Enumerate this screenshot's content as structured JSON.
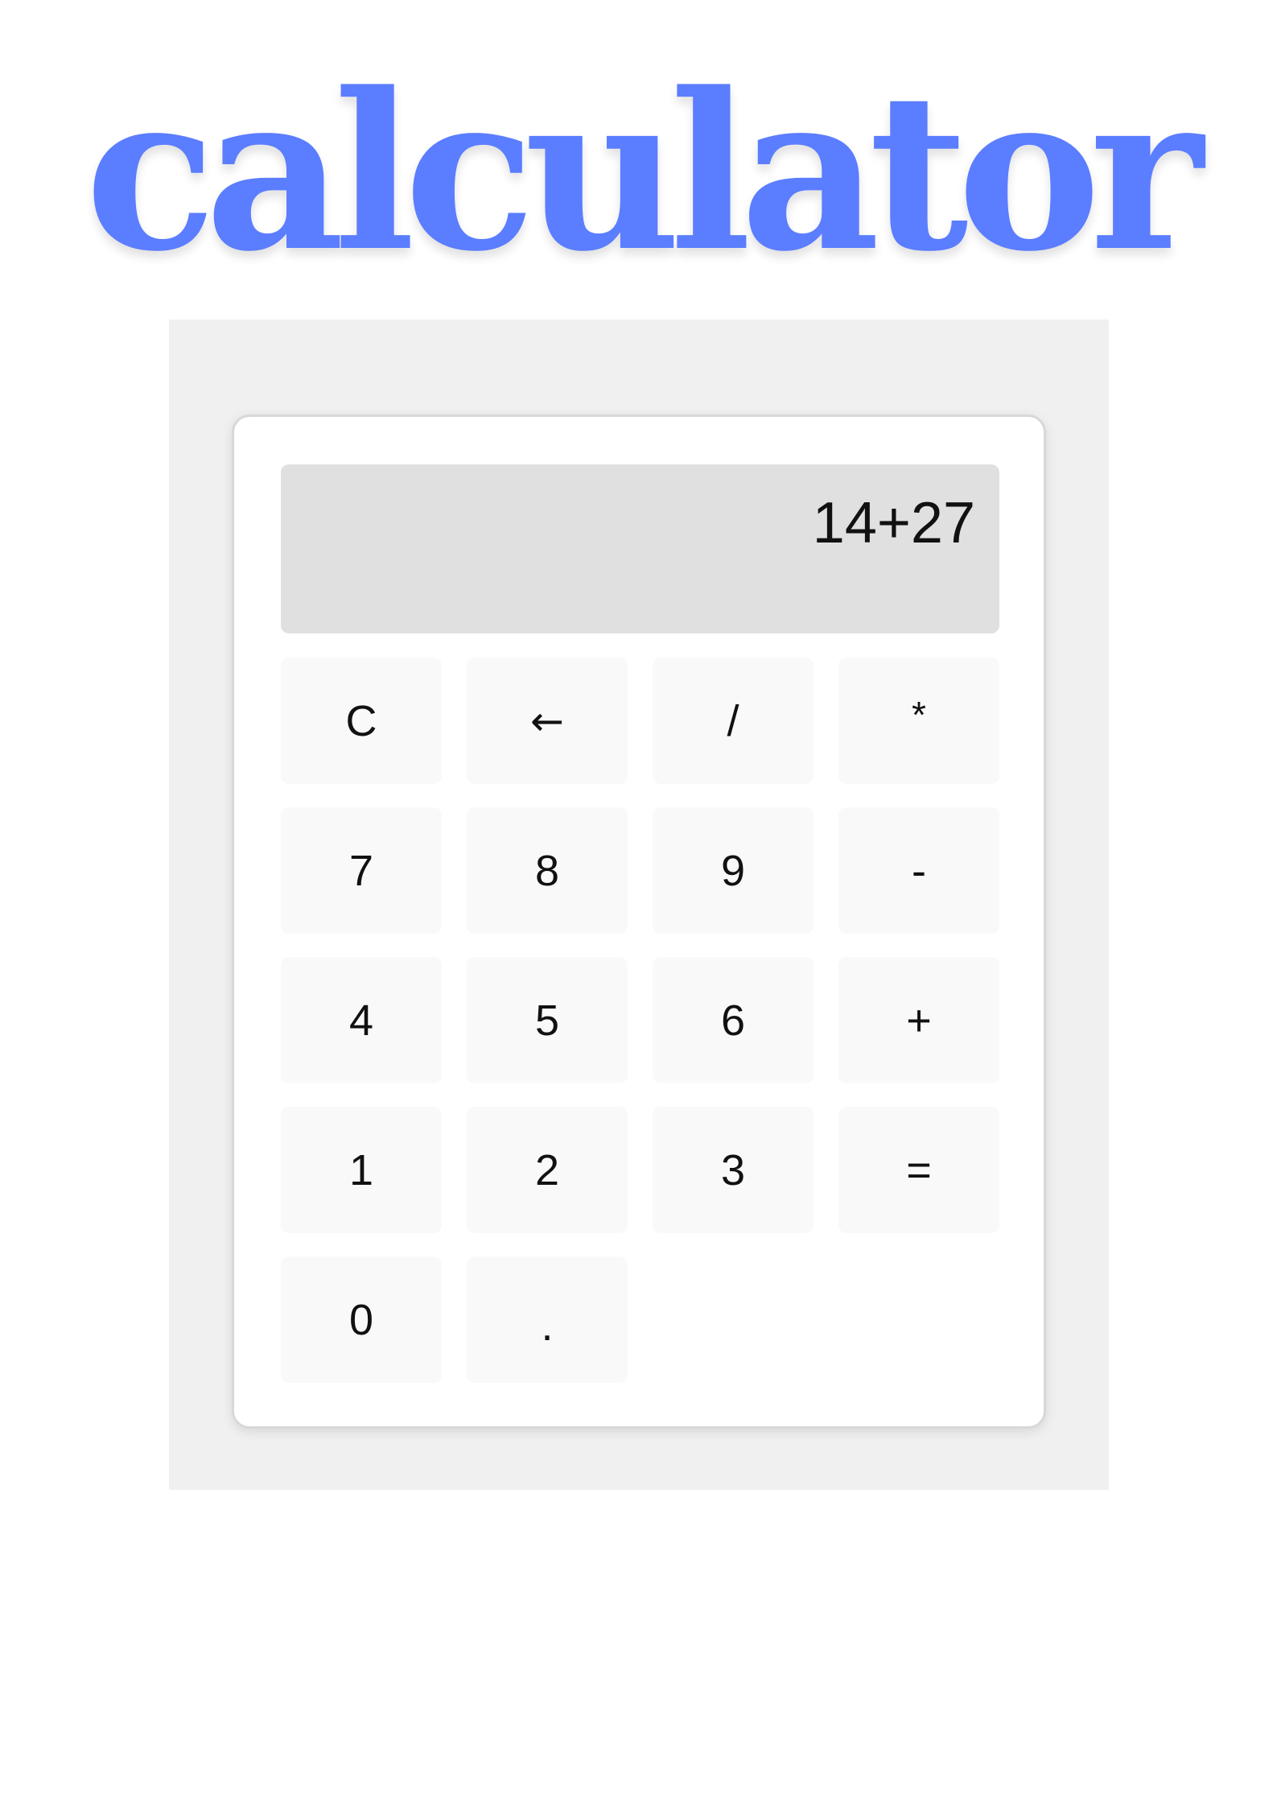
{
  "title": "calculator",
  "calculator": {
    "display": "14+27",
    "keys": [
      {
        "label": "C",
        "name": "clear-key"
      },
      {
        "label": "←",
        "name": "backspace-key"
      },
      {
        "label": "/",
        "name": "divide-key"
      },
      {
        "label": "*",
        "name": "multiply-key"
      },
      {
        "label": "7",
        "name": "digit-7-key"
      },
      {
        "label": "8",
        "name": "digit-8-key"
      },
      {
        "label": "9",
        "name": "digit-9-key"
      },
      {
        "label": "-",
        "name": "subtract-key"
      },
      {
        "label": "4",
        "name": "digit-4-key"
      },
      {
        "label": "5",
        "name": "digit-5-key"
      },
      {
        "label": "6",
        "name": "digit-6-key"
      },
      {
        "label": "+",
        "name": "add-key"
      },
      {
        "label": "1",
        "name": "digit-1-key"
      },
      {
        "label": "2",
        "name": "digit-2-key"
      },
      {
        "label": "3",
        "name": "digit-3-key"
      },
      {
        "label": "=",
        "name": "equals-key"
      },
      {
        "label": "0",
        "name": "digit-0-key"
      },
      {
        "label": ".",
        "name": "decimal-point-key"
      }
    ]
  },
  "colors": {
    "title": "#5b7dff",
    "stage_background": "#f0f0f0",
    "display_background": "#e0e0e0",
    "key_background": "#f9f9f9"
  }
}
